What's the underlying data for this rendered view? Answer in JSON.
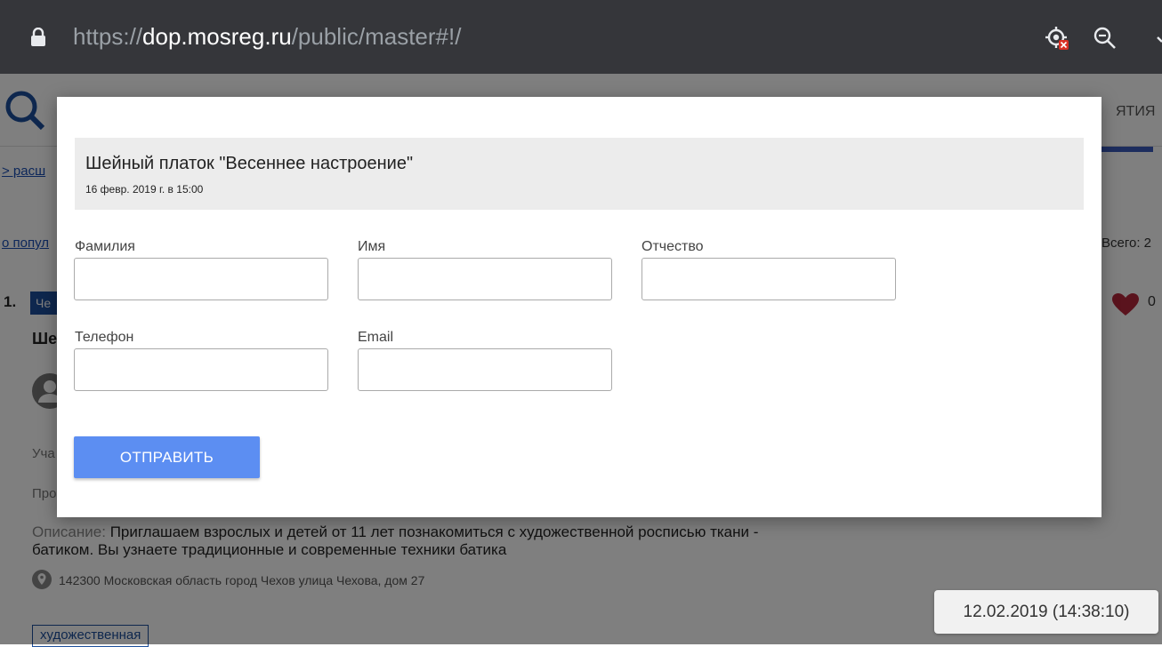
{
  "browser": {
    "url_scheme": "https://",
    "url_host": "dop.mosreg.ru",
    "url_path": "/public/master#!/"
  },
  "background_page": {
    "nav_tail": "ЯТИЯ",
    "link_advanced": "> расш",
    "link_popular": "о попул",
    "total_label": "Всего: 2",
    "item_number": "1.",
    "item_tag": "Че",
    "item_title": "Ше",
    "participants_label": "Уча",
    "held_label": "Про",
    "likes_count": "0",
    "description_label": "Описание:",
    "description_text": "Приглашаем взрослых и детей от 11 лет познакомиться с художественной росписью ткани - батиком. Вы узнаете традиционные и современные техники батика",
    "address": "142300 Московская область город Чехов улица Чехова, дом 27",
    "category_tag": "художественная"
  },
  "timestamp": "12.02.2019 (14:38:10)",
  "modal": {
    "event_title": "Шейный платок \"Весеннее настроение\"",
    "event_date": "16 февр. 2019 г. в 15:00",
    "fields": {
      "last_name_label": "Фамилия",
      "first_name_label": "Имя",
      "middle_name_label": "Отчество",
      "phone_label": "Телефон",
      "email_label": "Email"
    },
    "submit_label": "ОТПРАВИТЬ"
  },
  "colors": {
    "submit_button": "#5c8ef2",
    "address_bar": "#35363a",
    "heart": "#b5273a",
    "tag_blue": "#1d4f9c"
  }
}
